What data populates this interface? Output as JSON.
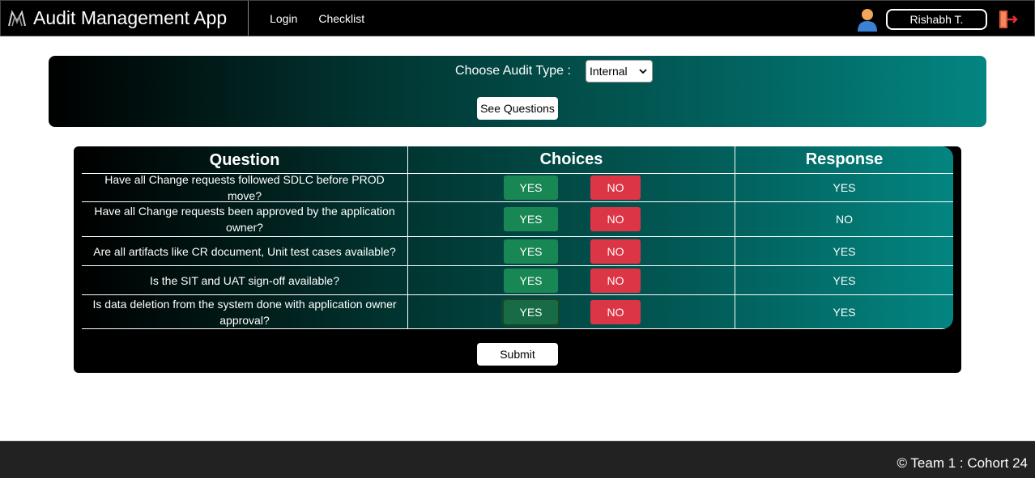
{
  "navbar": {
    "app_title": "Audit Management App",
    "links": [
      "Login",
      "Checklist"
    ],
    "user_name": "Rishabh T."
  },
  "audit_type": {
    "label": "Choose Audit Type :",
    "selected": "Internal",
    "see_questions": "See Questions"
  },
  "table": {
    "headers": [
      "Question",
      "Choices",
      "Response"
    ],
    "yes_label": "YES",
    "no_label": "NO",
    "rows": [
      {
        "question": "Have all Change requests followed SDLC before PROD move?",
        "response": "YES"
      },
      {
        "question": "Have all Change requests been approved by the application owner?",
        "response": "NO"
      },
      {
        "question": "Are all artifacts like CR document, Unit test cases available?",
        "response": "YES"
      },
      {
        "question": "Is the SIT and UAT sign-off available?",
        "response": "YES"
      },
      {
        "question": "Is data deletion from the system done with application owner approval?",
        "response": "YES"
      }
    ],
    "submit": "Submit"
  },
  "footer": {
    "text": "© Team 1 : Cohort 24"
  },
  "colors": {
    "yes": "#198754",
    "no": "#dc3545",
    "teal": "#038581"
  }
}
